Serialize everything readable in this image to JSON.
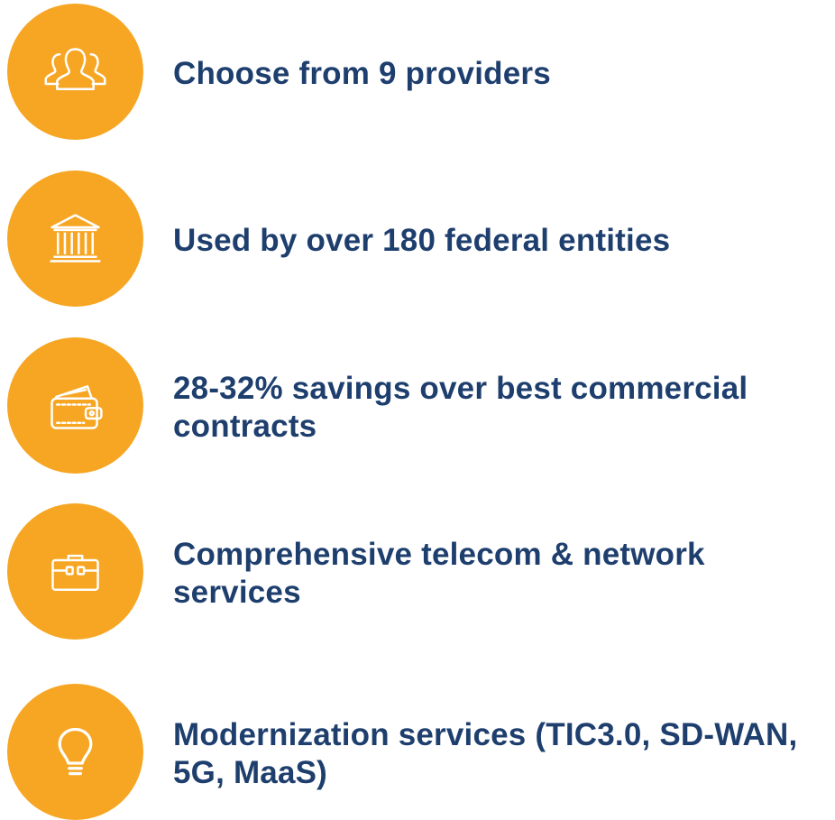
{
  "features": [
    {
      "label": "Choose from 9 providers",
      "icon": "people-group-icon"
    },
    {
      "label": "Used by over 180 federal entities",
      "icon": "government-building-icon"
    },
    {
      "label": "28-32% savings over best commercial contracts",
      "icon": "wallet-icon"
    },
    {
      "label": "Comprehensive telecom & network services",
      "icon": "briefcase-icon"
    },
    {
      "label": "Modernization services (TIC3.0, SD-WAN, 5G, MaaS)",
      "icon": "lightbulb-icon"
    }
  ],
  "colors": {
    "badge": "#F6A623",
    "icon_stroke": "#ffffff",
    "text": "#1e3f6e"
  }
}
